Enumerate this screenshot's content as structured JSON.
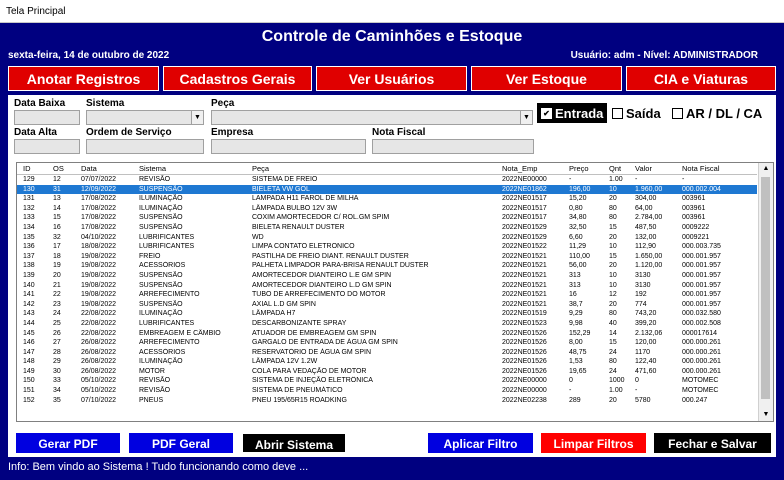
{
  "window": {
    "title": "Tela Principal"
  },
  "header": {
    "title": "Controle de Caminhões e Estoque",
    "date": "sexta-feira, 14 de outubro de 2022",
    "user": "Usuário: adm  - Nível: ADMINISTRADOR"
  },
  "nav": {
    "items": [
      "Anotar Registros",
      "Cadastros Gerais",
      "Ver Usuários",
      "Ver Estoque",
      "CIA e Viaturas"
    ]
  },
  "filters": {
    "labels": {
      "data_baixa": "Data Baixa",
      "sistema": "Sistema",
      "peca": "Peça",
      "data_alta": "Data Alta",
      "ordem_servico": "Ordem de Serviço",
      "empresa": "Empresa",
      "nota_fiscal": "Nota Fiscal"
    },
    "options": {
      "entrada": "Entrada",
      "saida": "Saída",
      "ar": "AR / DL / CA",
      "entrada_checked": true,
      "saida_checked": false,
      "ar_checked": false
    }
  },
  "table": {
    "columns": [
      "ID",
      "OS",
      "Data",
      "Sistema",
      "Peça",
      "Nota_Emp",
      "Preço",
      "Qnt",
      "Valor",
      "Nota Fiscal"
    ],
    "selected_index": 1,
    "rows": [
      [
        "129",
        "12",
        "07/07/2022",
        "REVISÃO",
        "SISTEMA DE FREIO",
        "2022NE00000",
        "-",
        "1.00",
        "-",
        "-"
      ],
      [
        "130",
        "31",
        "12/09/2022",
        "SUSPENSÃO",
        "BIELETA VW GOL",
        "2022NE01862",
        "196,00",
        "10",
        "1.960,00",
        "000.002.004"
      ],
      [
        "131",
        "13",
        "17/08/2022",
        "ILUMINAÇÃO",
        "LAMPADA H11 FAROL DE MILHA",
        "2022NE01517",
        "15,20",
        "20",
        "304,00",
        "003961"
      ],
      [
        "132",
        "14",
        "17/08/2022",
        "ILUMINAÇÃO",
        "LÂMPADA BULBO 12V 3W",
        "2022NE01517",
        "0,80",
        "80",
        "64,00",
        "003961"
      ],
      [
        "133",
        "15",
        "17/08/2022",
        "SUSPENSÃO",
        "COXIM AMORTECEDOR C/ ROL.GM SPIM",
        "2022NE01517",
        "34,80",
        "80",
        "2.784,00",
        "003961"
      ],
      [
        "134",
        "16",
        "17/08/2022",
        "SUSPENSÃO",
        "BIELETA RENAULT DUSTER",
        "2022NE01529",
        "32,50",
        "15",
        "487,50",
        "0009222"
      ],
      [
        "135",
        "32",
        "04/10/2022",
        "LUBRIFICANTES",
        "WD",
        "2022NE01529",
        "6,60",
        "20",
        "132,00",
        "0009221"
      ],
      [
        "136",
        "17",
        "18/08/2022",
        "LUBRIFICANTES",
        "LIMPA CONTATO ELETRONICO",
        "2022NE01522",
        "11,29",
        "10",
        "112,90",
        "000.003.735"
      ],
      [
        "137",
        "18",
        "19/08/2022",
        "FREIO",
        "PASTILHA DE FREIO DIANT. RENAULT DUSTER",
        "2022NE01521",
        "110,00",
        "15",
        "1.650,00",
        "000.001.957"
      ],
      [
        "138",
        "19",
        "19/08/2022",
        "ACESSÓRIOS",
        "PALHETA LIMPADOR PARA-BRISA RENAULT DUSTER",
        "2022NE01521",
        "56,00",
        "20",
        "1.120,00",
        "000.001.957"
      ],
      [
        "139",
        "20",
        "19/08/2022",
        "SUSPENSÃO",
        "AMORTECEDOR DIANTEIRO L.E GM SPIN",
        "2022NE01521",
        "313",
        "10",
        "3130",
        "000.001.957"
      ],
      [
        "140",
        "21",
        "19/08/2022",
        "SUSPENSÃO",
        "AMORTECEDOR DIANTEIRO L.D GM SPIN",
        "2022NE01521",
        "313",
        "10",
        "3130",
        "000.001.957"
      ],
      [
        "141",
        "22",
        "19/08/2022",
        "ARREFECIMENTO",
        "TUBO DE ARREFECIMENTO DO MOTOR",
        "2022NE01521",
        "16",
        "12",
        "192",
        "000.001.957"
      ],
      [
        "142",
        "23",
        "19/08/2022",
        "SUSPENSÃO",
        "AXIAL L.D GM SPIN",
        "2022NE01521",
        "38,7",
        "20",
        "774",
        "000.001.957"
      ],
      [
        "143",
        "24",
        "22/08/2022",
        "ILUMINAÇÃO",
        "LÂMPADA H7",
        "2022NE01519",
        "9,29",
        "80",
        "743,20",
        "000.032.580"
      ],
      [
        "144",
        "25",
        "22/08/2022",
        "LUBRIFICANTES",
        "DESCARBONIZANTE SPRAY",
        "2022NE01523",
        "9,98",
        "40",
        "399,20",
        "000.002.508"
      ],
      [
        "145",
        "26",
        "22/08/2022",
        "EMBREAGEM E CÂMBIO",
        "ATUADOR DE EMBREAGEM GM SPIN",
        "2022NE01526",
        "152,29",
        "14",
        "2.132,06",
        "000017614"
      ],
      [
        "146",
        "27",
        "26/08/2022",
        "ARREFECIMENTO",
        "GARGALO DE ENTRADA DE ÁGUA GM SPIN",
        "2022NE01526",
        "8,00",
        "15",
        "120,00",
        "000.000.261"
      ],
      [
        "147",
        "28",
        "26/08/2022",
        "ACESSÓRIOS",
        "RESERVATÓRIO DE ÁGUA GM SPIN",
        "2022NE01526",
        "48,75",
        "24",
        "1170",
        "000.000.261"
      ],
      [
        "148",
        "29",
        "26/08/2022",
        "ILUMINAÇÃO",
        "LÂMPADA 12V 1.2W",
        "2022NE01526",
        "1,53",
        "80",
        "122,40",
        "000.000.261"
      ],
      [
        "149",
        "30",
        "26/08/2022",
        "MOTOR",
        "COLA PARA VEDAÇÃO DE MOTOR",
        "2022NE01526",
        "19,65",
        "24",
        "471,60",
        "000.000.261"
      ],
      [
        "150",
        "33",
        "05/10/2022",
        "REVISÃO",
        "SISTEMA DE INJEÇÃO ELETRÔNICA",
        "2022NE00000",
        "0",
        "1000",
        "0",
        "MOTOMEC"
      ],
      [
        "151",
        "34",
        "05/10/2022",
        "REVISÃO",
        "SISTEMA DE PNEUMÁTICO",
        "2022NE00000",
        "-",
        "1.00",
        "-",
        "MOTOMEC"
      ],
      [
        "152",
        "35",
        "07/10/2022",
        "PNEUS",
        "PNEU 195/65R15 ROADKING",
        "2022NE02238",
        "289",
        "20",
        "5780",
        "000.247"
      ]
    ]
  },
  "actions": {
    "gerar_pdf": "Gerar PDF",
    "pdf_geral": "PDF Geral",
    "abrir_sistema": "Abrir Sistema",
    "aplicar_filtro": "Aplicar Filtro",
    "limpar_filtros": "Limpar Filtros",
    "fechar_salvar": "Fechar e Salvar"
  },
  "status": {
    "info": "Info:  Bem vindo ao Sistema ! Tudo funcionando como deve ..."
  },
  "colors": {
    "background": "#000080",
    "nav_button": "#e00000",
    "selection": "#1e78d2",
    "blue_button": "#0000e0",
    "red_button": "#ff0000",
    "black_button": "#000000"
  },
  "icons": {
    "combo_arrow": "chevron-down-icon",
    "scroll_up": "arrow-up-icon",
    "scroll_down": "arrow-down-icon"
  }
}
